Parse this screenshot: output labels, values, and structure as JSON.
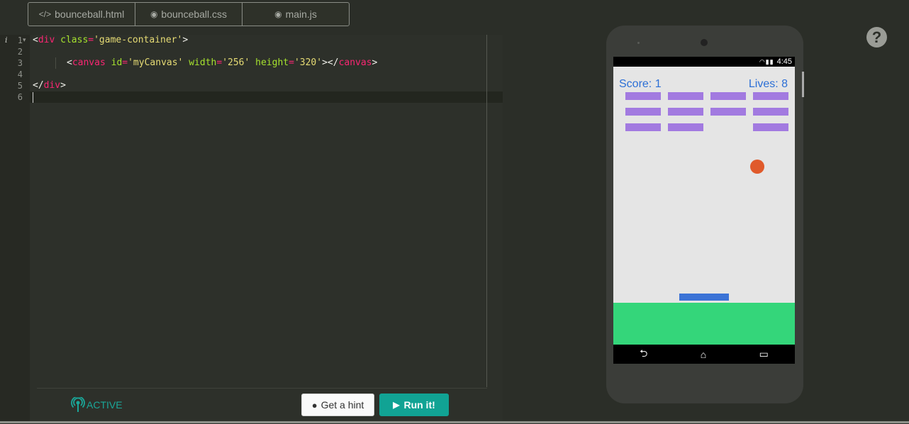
{
  "tabs": [
    {
      "label": "bounceball.html",
      "icon": "</>"
    },
    {
      "label": "bounceball.css",
      "icon": "◉"
    },
    {
      "label": "main.js",
      "icon": "◉"
    }
  ],
  "editor": {
    "line_numbers": [
      "1",
      "2",
      "3",
      "4",
      "5",
      "6"
    ],
    "info_mark": "i"
  },
  "status": {
    "label": "ACTIVE"
  },
  "buttons": {
    "hint": "Get a hint",
    "run": "Run it!"
  },
  "help": {
    "label": "?"
  },
  "phone": {
    "time": "4:45",
    "score_text": "Score: 1",
    "lives_text": "Lives: 8"
  },
  "colors": {
    "accent": "#11a394",
    "score_text": "#2c6fd6",
    "brick": "#a27ae0",
    "ball": "#e05a2b",
    "paddle": "#3b73d6",
    "ground": "#34d67a"
  }
}
